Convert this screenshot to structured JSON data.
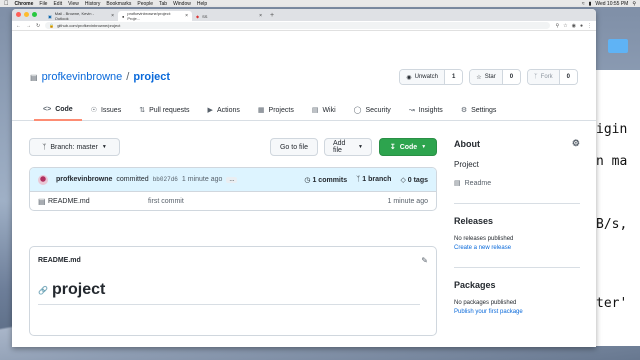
{
  "menubar": {
    "app": "Chrome",
    "items": [
      "File",
      "Edit",
      "View",
      "History",
      "Bookmarks",
      "People",
      "Tab",
      "Window",
      "Help"
    ],
    "clock": "Wed 10:55 PM"
  },
  "desktop": {
    "icon_label": ""
  },
  "terminal_lines": [
    "igin",
    "n ma",
    "B/s,",
    "ter'"
  ],
  "browser": {
    "tabs": [
      {
        "title": "Mail - Browne, Kevin - Outlook"
      },
      {
        "title": "profkevinbrowne/project: Proje..."
      },
      {
        "title": "SS"
      }
    ],
    "url": "github.com/profkevinbrowne/project"
  },
  "repo": {
    "owner": "profkevinbrowne",
    "separator": "/",
    "name": "project",
    "unwatch": {
      "label": "Unwatch",
      "count": "1"
    },
    "star": {
      "label": "Star",
      "count": "0"
    },
    "fork": {
      "label": "Fork",
      "count": "0"
    }
  },
  "nav": [
    {
      "label": "Code"
    },
    {
      "label": "Issues"
    },
    {
      "label": "Pull requests"
    },
    {
      "label": "Actions"
    },
    {
      "label": "Projects"
    },
    {
      "label": "Wiki"
    },
    {
      "label": "Security"
    },
    {
      "label": "Insights"
    },
    {
      "label": "Settings"
    }
  ],
  "toolbar": {
    "branch": "Branch: master",
    "goto": "Go to file",
    "addfile": "Add file",
    "code": "Code"
  },
  "commit": {
    "author": "profkevinbrowne",
    "action": "committed",
    "sha": "bb027d6",
    "age": "1 minute ago",
    "dots": "...",
    "commits": "1 commits",
    "branches": "1 branch",
    "tags": "0 tags"
  },
  "files": [
    {
      "name": "README.md",
      "message": "first commit",
      "age": "1 minute ago"
    }
  ],
  "readme": {
    "title": "README.md",
    "heading": "project"
  },
  "sidebar": {
    "about": "About",
    "description": "Project",
    "readme_link": "Readme",
    "releases": "Releases",
    "no_releases": "No releases published",
    "create_release": "Create a new release",
    "packages": "Packages",
    "no_packages": "No packages published",
    "publish_package": "Publish your first package"
  },
  "colors": {
    "accent_link": "#0969da",
    "code_button": "#2da44e",
    "active_tab_underline": "#fd8c73",
    "commit_bar": "#ddf4ff"
  }
}
